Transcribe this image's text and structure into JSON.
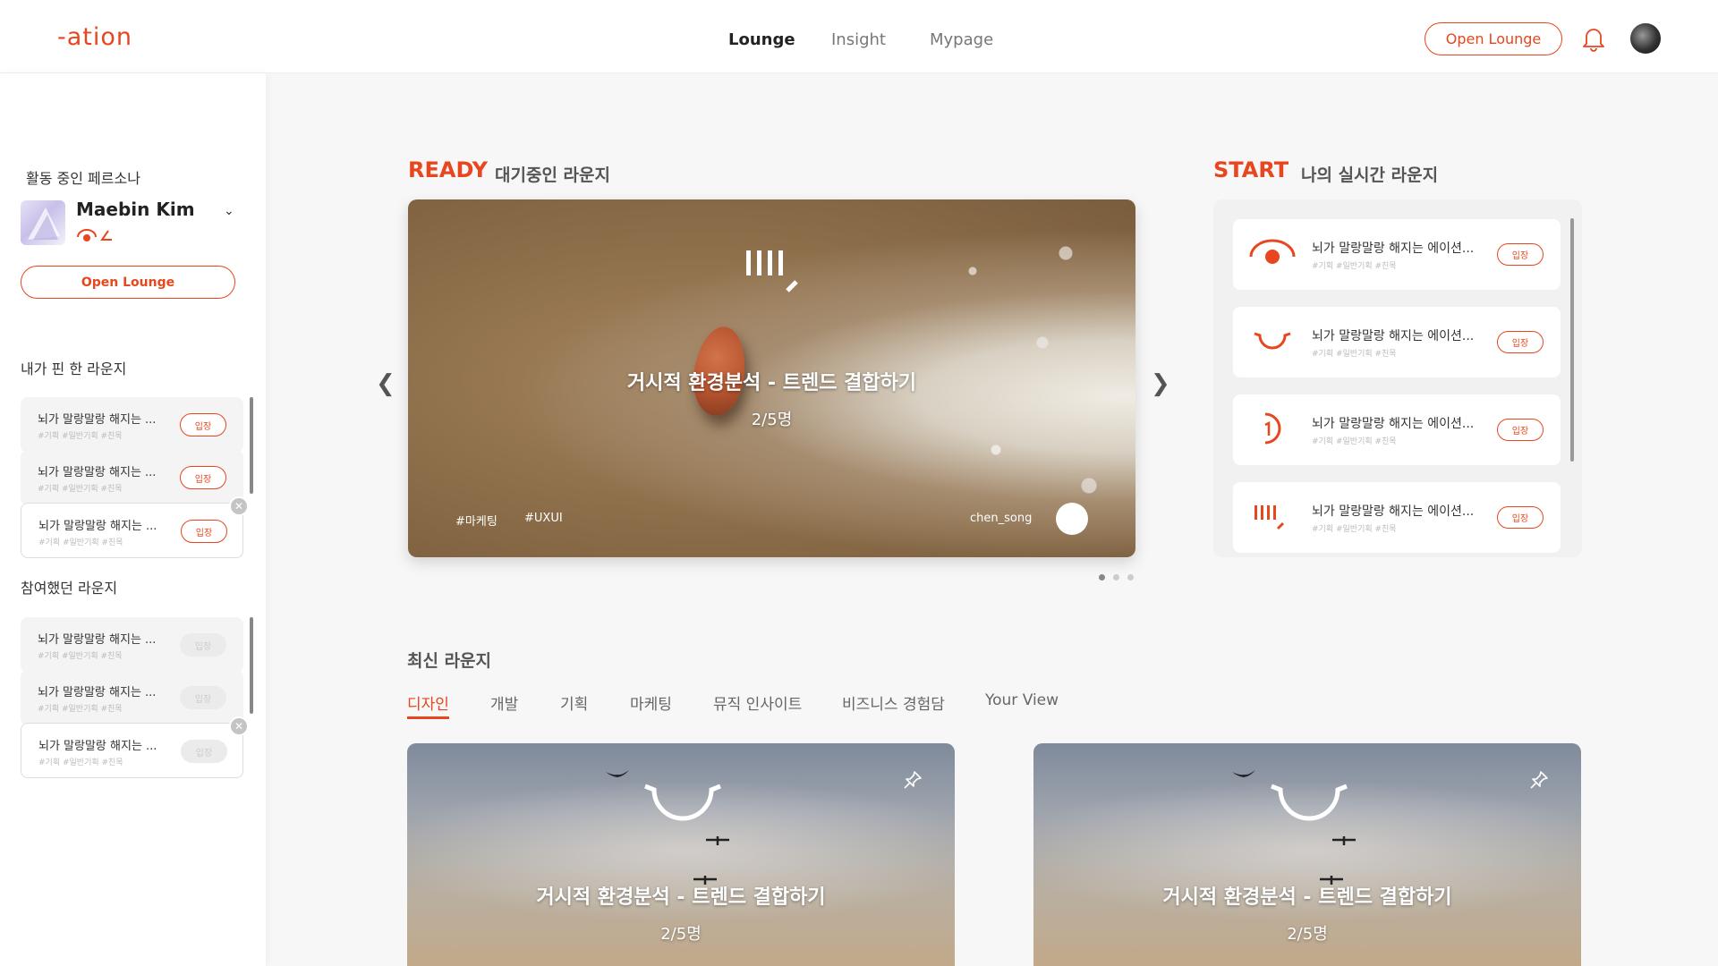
{
  "header": {
    "logo": "-ation",
    "nav": [
      {
        "label": "Lounge",
        "active": true
      },
      {
        "label": "Insight",
        "active": false
      },
      {
        "label": "Mypage",
        "active": false
      }
    ],
    "open_lounge_label": "Open Lounge",
    "icons": [
      "bell-icon",
      "avatar"
    ]
  },
  "sidebar": {
    "persona_title": "활동 중인 페르소나",
    "persona_name": "Maebin Kim",
    "open_lounge_label": "Open Lounge",
    "pinned_title": "내가 핀 한 라운지",
    "pinned": [
      {
        "title": "뇌가 말랑말랑 해지는 ...",
        "tags": "#기획 #일반기획 #친목",
        "enter": "입장",
        "enabled": true
      },
      {
        "title": "뇌가 말랑말랑 해지는 ...",
        "tags": "#기획 #일반기획 #친목",
        "enter": "입장",
        "enabled": true
      },
      {
        "title": "뇌가 말랑말랑 해지는 ...",
        "tags": "#기획 #일반기획 #친목",
        "enter": "입장",
        "enabled": true
      }
    ],
    "joined_title": "참여했던 라운지",
    "joined": [
      {
        "title": "뇌가 말랑말랑 해지는 ...",
        "tags": "#기획 #일반기획 #친목",
        "enter": "입장",
        "enabled": false
      },
      {
        "title": "뇌가 말랑말랑 해지는 ...",
        "tags": "#기획 #일반기획 #친목",
        "enter": "입장",
        "enabled": false
      },
      {
        "title": "뇌가 말랑말랑 해지는 ...",
        "tags": "#기획 #일반기획 #친목",
        "enter": "입장",
        "enabled": false
      }
    ]
  },
  "ready": {
    "title": "READY",
    "subtitle": "대기중인 라운지",
    "hero": {
      "title": "거시적 환경분석 - 트렌드 결합하기",
      "count": "2/5명",
      "tags": [
        "#마케팅",
        "#UXUI"
      ],
      "user": "chen_song"
    },
    "pagination": {
      "total": 3,
      "current": 1
    }
  },
  "start": {
    "title": "START",
    "subtitle": "나의 실시간 라운지",
    "items": [
      {
        "icon": "eye-icon",
        "title": "뇌가 말랑말랑 해지는 에이션...",
        "tags": "#기획 #일반기획 #친목",
        "enter": "입장"
      },
      {
        "icon": "smile-icon",
        "title": "뇌가 말랑말랑 해지는 에이션...",
        "tags": "#기획 #일반기획 #친목",
        "enter": "입장"
      },
      {
        "icon": "ear-icon",
        "title": "뇌가 말랑말랑 해지는 에이션...",
        "tags": "#기획 #일반기획 #친목",
        "enter": "입장"
      },
      {
        "icon": "lines-icon",
        "title": "뇌가 말랑말랑 해지는 에이션...",
        "tags": "#기획 #일반기획 #친목",
        "enter": "입장"
      }
    ]
  },
  "latest": {
    "title": "최신 라운지",
    "tabs": [
      {
        "label": "디자인",
        "active": true
      },
      {
        "label": "개발",
        "active": false
      },
      {
        "label": "기획",
        "active": false
      },
      {
        "label": "마케팅",
        "active": false
      },
      {
        "label": "뮤직 인사이트",
        "active": false
      },
      {
        "label": "비즈니스 경험담",
        "active": false
      },
      {
        "label": "Your View",
        "active": false
      }
    ],
    "cards": [
      {
        "title": "거시적 환경분석 - 트렌드 결합하기",
        "count": "2/5명"
      },
      {
        "title": "거시적 환경분석 - 트렌드 결합하기",
        "count": "2/5명"
      }
    ]
  },
  "colors": {
    "accent": "#e8461e",
    "background": "#f7f7f7"
  }
}
